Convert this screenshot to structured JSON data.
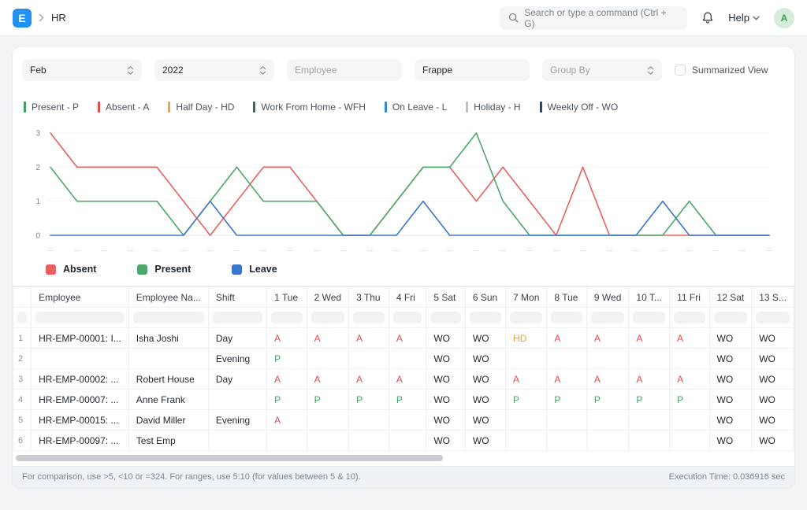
{
  "navbar": {
    "logo_letter": "E",
    "breadcrumb": "HR",
    "search_placeholder": "Search or type a command (Ctrl + G)",
    "help_label": "Help",
    "avatar_initial": "A"
  },
  "filters": {
    "month": "Feb",
    "year": "2022",
    "employee_placeholder": "Employee",
    "company_value": "Frappe",
    "group_by_placeholder": "Group By",
    "summarized_view_label": "Summarized View"
  },
  "status_legend": [
    {
      "label": "Present - P",
      "color": "#41a05e"
    },
    {
      "label": "Absent - A",
      "color": "#e24c4c"
    },
    {
      "label": "Half Day - HD",
      "color": "#eca842"
    },
    {
      "label": "Work From Home - WFH",
      "color": "#4c5a67"
    },
    {
      "label": "On Leave - L",
      "color": "#318ad8"
    },
    {
      "label": "Holiday - H",
      "color": "#b8c0c8"
    },
    {
      "label": "Weekly Off - WO",
      "color": "#27497a"
    }
  ],
  "chart_data": {
    "type": "line",
    "title": "",
    "x_day_index": [
      1,
      2,
      3,
      4,
      5,
      6,
      7,
      8,
      9,
      10,
      11,
      12,
      13,
      14,
      15,
      16,
      17,
      18,
      19,
      20,
      21,
      22,
      23,
      24,
      25,
      26,
      27,
      28
    ],
    "xtick_display": "...",
    "yticks": [
      0,
      1,
      2,
      3
    ],
    "ylim": [
      0,
      3
    ],
    "grid": "horizontal-light",
    "legend_position": "bottom-left",
    "series": [
      {
        "name": "Absent",
        "color": "#e86060",
        "values": [
          3,
          2,
          2,
          2,
          2,
          1,
          0,
          1,
          2,
          2,
          1,
          0,
          0,
          1,
          2,
          2,
          1,
          2,
          1,
          0,
          2,
          0,
          0,
          0,
          0,
          0,
          0,
          0
        ]
      },
      {
        "name": "Present",
        "color": "#4ea86a",
        "values": [
          2,
          1,
          1,
          1,
          1,
          0,
          1,
          2,
          1,
          1,
          1,
          0,
          0,
          1,
          2,
          2,
          3,
          1,
          0,
          0,
          0,
          0,
          0,
          0,
          1,
          0,
          0,
          0
        ]
      },
      {
        "name": "Leave",
        "color": "#3b76c8",
        "values": [
          0,
          0,
          0,
          0,
          0,
          0,
          1,
          0,
          0,
          0,
          0,
          0,
          0,
          0,
          1,
          0,
          0,
          0,
          0,
          0,
          0,
          0,
          0,
          1,
          0,
          0,
          0,
          0
        ]
      }
    ]
  },
  "table": {
    "columns": [
      "",
      "Employee",
      "Employee Na...",
      "Shift",
      "1 Tue",
      "2 Wed",
      "3 Thu",
      "4 Fri",
      "5 Sat",
      "6 Sun",
      "7 Mon",
      "8 Tue",
      "9 Wed",
      "10 T...",
      "11 Fri",
      "12 Sat",
      "13 S..."
    ],
    "cell_colors": {
      "A": "#e24c4c",
      "P": "#40a460",
      "HD": "#e8a33d",
      "WO": "#20262c"
    },
    "rows": [
      {
        "idx": "1",
        "employee": "HR-EMP-00001: I...",
        "name": "Isha Joshi",
        "shift": "Day",
        "days": [
          "A",
          "A",
          "A",
          "A",
          "WO",
          "WO",
          "HD",
          "A",
          "A",
          "A",
          "A",
          "WO",
          "WO"
        ]
      },
      {
        "idx": "2",
        "employee": "",
        "name": "",
        "shift": "Evening",
        "days": [
          "P",
          "",
          "",
          "",
          "WO",
          "WO",
          "",
          "",
          "",
          "",
          "",
          "WO",
          "WO"
        ]
      },
      {
        "idx": "3",
        "employee": "HR-EMP-00002: ...",
        "name": "Robert House",
        "shift": "Day",
        "days": [
          "A",
          "A",
          "A",
          "A",
          "WO",
          "WO",
          "A",
          "A",
          "A",
          "A",
          "A",
          "WO",
          "WO"
        ]
      },
      {
        "idx": "4",
        "employee": "HR-EMP-00007: ...",
        "name": "Anne Frank",
        "shift": "",
        "days": [
          "P",
          "P",
          "P",
          "P",
          "WO",
          "WO",
          "P",
          "P",
          "P",
          "P",
          "P",
          "WO",
          "WO"
        ]
      },
      {
        "idx": "5",
        "employee": "HR-EMP-00015: ...",
        "name": "David Miller",
        "shift": "Evening",
        "days": [
          "A",
          "",
          "",
          "",
          "WO",
          "WO",
          "",
          "",
          "",
          "",
          "",
          "WO",
          "WO"
        ]
      },
      {
        "idx": "6",
        "employee": "HR-EMP-00097: ...",
        "name": "Test Emp",
        "shift": "",
        "days": [
          "",
          "",
          "",
          "",
          "WO",
          "WO",
          "",
          "",
          "",
          "",
          "",
          "WO",
          "WO"
        ]
      }
    ]
  },
  "footer": {
    "hint": "For comparison, use >5, <10 or =324. For ranges, use 5:10 (for values between 5 & 10).",
    "execution_time": "Execution Time: 0.036916 sec"
  }
}
